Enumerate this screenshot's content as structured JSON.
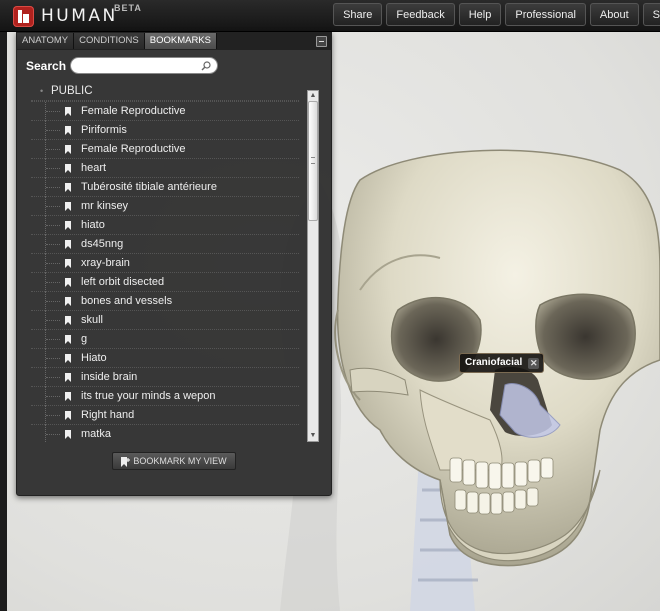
{
  "header": {
    "logo_text": "HUMAN",
    "beta_label": "BETA",
    "nav": [
      {
        "label": "Share"
      },
      {
        "label": "Feedback"
      },
      {
        "label": "Help"
      },
      {
        "label": "Professional"
      },
      {
        "label": "About"
      },
      {
        "label": "S"
      }
    ]
  },
  "panel": {
    "tabs": [
      {
        "label": "ANATOMY"
      },
      {
        "label": "CONDITIONS"
      },
      {
        "label": "BOOKMARKS",
        "active": true
      }
    ],
    "search": {
      "label": "Search",
      "value": "",
      "placeholder": ""
    },
    "tree": {
      "root": "PUBLIC",
      "items": [
        "Female Reproductive",
        "Piriformis",
        "Female Reproductive",
        "heart",
        "Tubérosité tibiale antérieure",
        "mr kinsey",
        "hiato",
        "ds45nng",
        "xray-brain",
        "left orbit disected",
        "bones and vessels",
        "skull",
        "g",
        "Hiato",
        "inside brain",
        "its true your minds a wepon",
        "Right hand",
        "matka"
      ]
    },
    "bookmark_button": "BOOKMARK MY VIEW"
  },
  "view": {
    "tooltip": {
      "label": "Craniofacial",
      "close": "✕"
    }
  },
  "colors": {
    "accent": "#b0221e",
    "panel_bg": "#303030",
    "topbar_bg": "#1a1a1a"
  }
}
